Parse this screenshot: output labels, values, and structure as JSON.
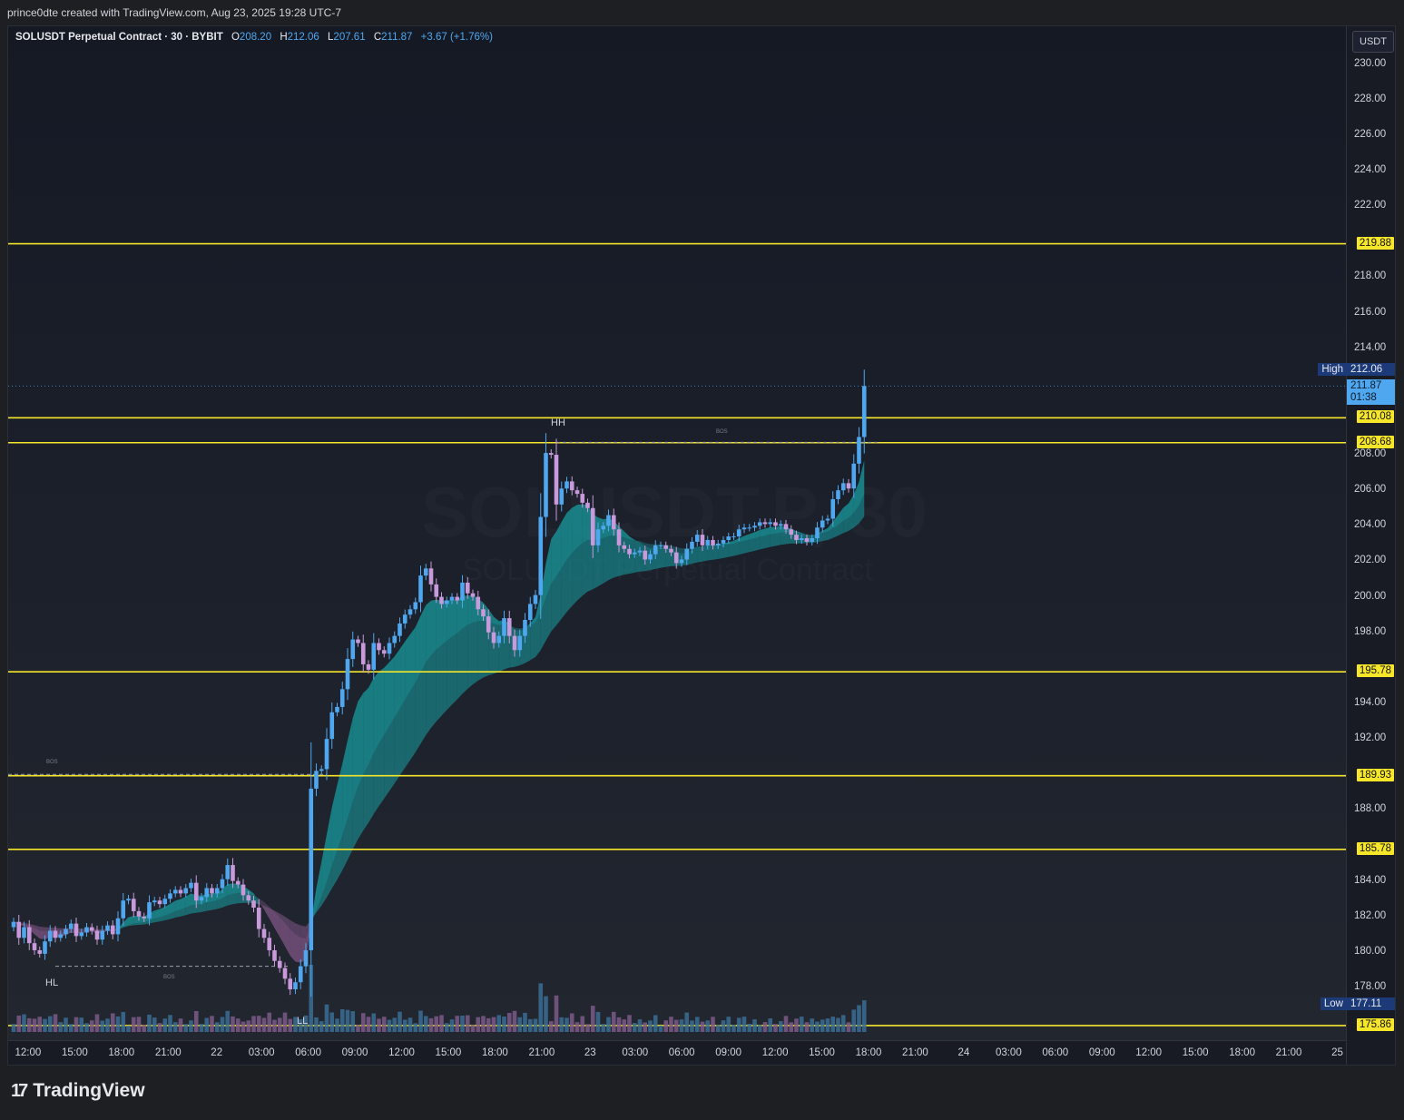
{
  "header": {
    "caption": "prince0dte created with TradingView.com, Aug 23, 2025 19:28 UTC-7"
  },
  "legend": {
    "title": "SOLUSDT Perpetual Contract · 30 · BYBIT",
    "o_label": "O",
    "o_value": "208.20",
    "h_label": "H",
    "h_value": "212.06",
    "l_label": "L",
    "l_value": "207.61",
    "c_label": "C",
    "c_value": "211.87",
    "change": "+3.67 (+1.76%)"
  },
  "currency_button": "USDT",
  "watermark": {
    "symbol": "SOLUSDT.P, 30",
    "name": "SOLUSDT Perpetual Contract"
  },
  "footer": {
    "brand": "TradingView",
    "logo_glyph": "17"
  },
  "price_labels": {
    "high_tag": "High",
    "high_value": "212.06",
    "current_value": "211.87",
    "countdown": "01:38",
    "low_tag": "Low",
    "low_value": "177.11"
  },
  "annotations": {
    "hh": "HH",
    "hl": "HL",
    "ll": "LL",
    "bos": "BOS"
  },
  "colors": {
    "up": "#4fa8ef",
    "down": "#c99adb",
    "level": "#f5e62a",
    "ribbon_bull": "#17a2a6",
    "ribbon_bear": "#8a5c8f",
    "volume_up": "#3a6f94",
    "volume_down": "#7b5a88"
  },
  "chart_data": {
    "type": "candlestick",
    "title": "SOLUSDT Perpetual Contract · 30 · BYBIT",
    "ylim": [
      175.5,
      231
    ],
    "y_ticks": [
      "230.00",
      "228.00",
      "226.00",
      "224.00",
      "222.00",
      "218.00",
      "216.00",
      "214.00",
      "208.00",
      "206.00",
      "204.00",
      "202.00",
      "200.00",
      "198.00",
      "194.00",
      "192.00",
      "188.00",
      "184.00",
      "182.00",
      "180.00",
      "178.00"
    ],
    "x_ticks": [
      "12:00",
      "15:00",
      "18:00",
      "21:00",
      "22",
      "03:00",
      "06:00",
      "09:00",
      "12:00",
      "15:00",
      "18:00",
      "21:00",
      "23",
      "03:00",
      "06:00",
      "09:00",
      "12:00",
      "15:00",
      "18:00",
      "21:00",
      "24",
      "03:00",
      "06:00",
      "09:00",
      "12:00",
      "15:00",
      "18:00",
      "21:00",
      "25"
    ],
    "levels": [
      {
        "value": 219.88,
        "label": "219.88"
      },
      {
        "value": 210.08,
        "label": "210.08"
      },
      {
        "value": 208.68,
        "label": "208.68"
      },
      {
        "value": 195.78,
        "label": "195.78"
      },
      {
        "value": 189.93,
        "label": "189.93"
      },
      {
        "value": 185.78,
        "label": "185.78"
      },
      {
        "value": 175.86,
        "label": "175.86"
      }
    ],
    "high": 212.06,
    "low": 177.11,
    "last": 211.87,
    "closes": [
      181.7,
      180.8,
      181.4,
      180.5,
      180.1,
      179.9,
      180.6,
      181.2,
      180.8,
      181.0,
      181.3,
      181.6,
      180.9,
      181.1,
      181.4,
      181.2,
      180.7,
      181.2,
      181.5,
      181.0,
      181.9,
      182.9,
      183.0,
      182.3,
      182.0,
      181.9,
      182.8,
      182.9,
      182.7,
      183.0,
      183.3,
      183.5,
      183.3,
      183.6,
      183.9,
      182.9,
      183.1,
      183.6,
      183.3,
      183.6,
      184.1,
      184.9,
      184.0,
      183.8,
      183.2,
      182.9,
      182.5,
      181.3,
      180.8,
      180.1,
      179.5,
      179.1,
      178.5,
      177.9,
      178.3,
      179.2,
      180.1,
      189.2,
      190.2,
      190.3,
      192.0,
      193.5,
      193.8,
      194.8,
      196.5,
      197.6,
      197.4,
      196.2,
      195.9,
      197.4,
      197.0,
      196.8,
      197.4,
      197.8,
      198.5,
      199.0,
      199.3,
      199.7,
      201.2,
      201.6,
      200.7,
      200.0,
      199.6,
      199.8,
      200.0,
      199.8,
      200.8,
      200.2,
      200.0,
      199.3,
      198.9,
      198.0,
      197.4,
      197.8,
      198.8,
      197.8,
      197.0,
      197.8,
      198.7,
      199.6,
      200.1,
      204.5,
      208.1,
      208.0,
      205.2,
      206.1,
      206.5,
      206.0,
      205.8,
      205.3,
      205.0,
      202.9,
      203.8,
      204.0,
      204.6,
      203.8,
      202.9,
      202.7,
      202.4,
      202.5,
      202.6,
      202.1,
      202.4,
      202.9,
      202.9,
      202.7,
      202.5,
      201.9,
      202.1,
      202.7,
      203.1,
      203.5,
      202.9,
      203.2,
      202.9,
      203.0,
      203.2,
      203.4,
      203.4,
      203.8,
      203.9,
      203.9,
      204.0,
      204.2,
      204.1,
      204.2,
      204.0,
      204.1,
      203.8,
      203.5,
      203.2,
      203.3,
      203.1,
      203.3,
      203.9,
      204.3,
      204.4,
      205.5,
      206.0,
      206.4,
      206.1,
      207.5,
      209.0,
      211.87
    ],
    "series": [
      {
        "name": "Price (30m)",
        "note": "close values above, 30-minute bars"
      }
    ]
  }
}
